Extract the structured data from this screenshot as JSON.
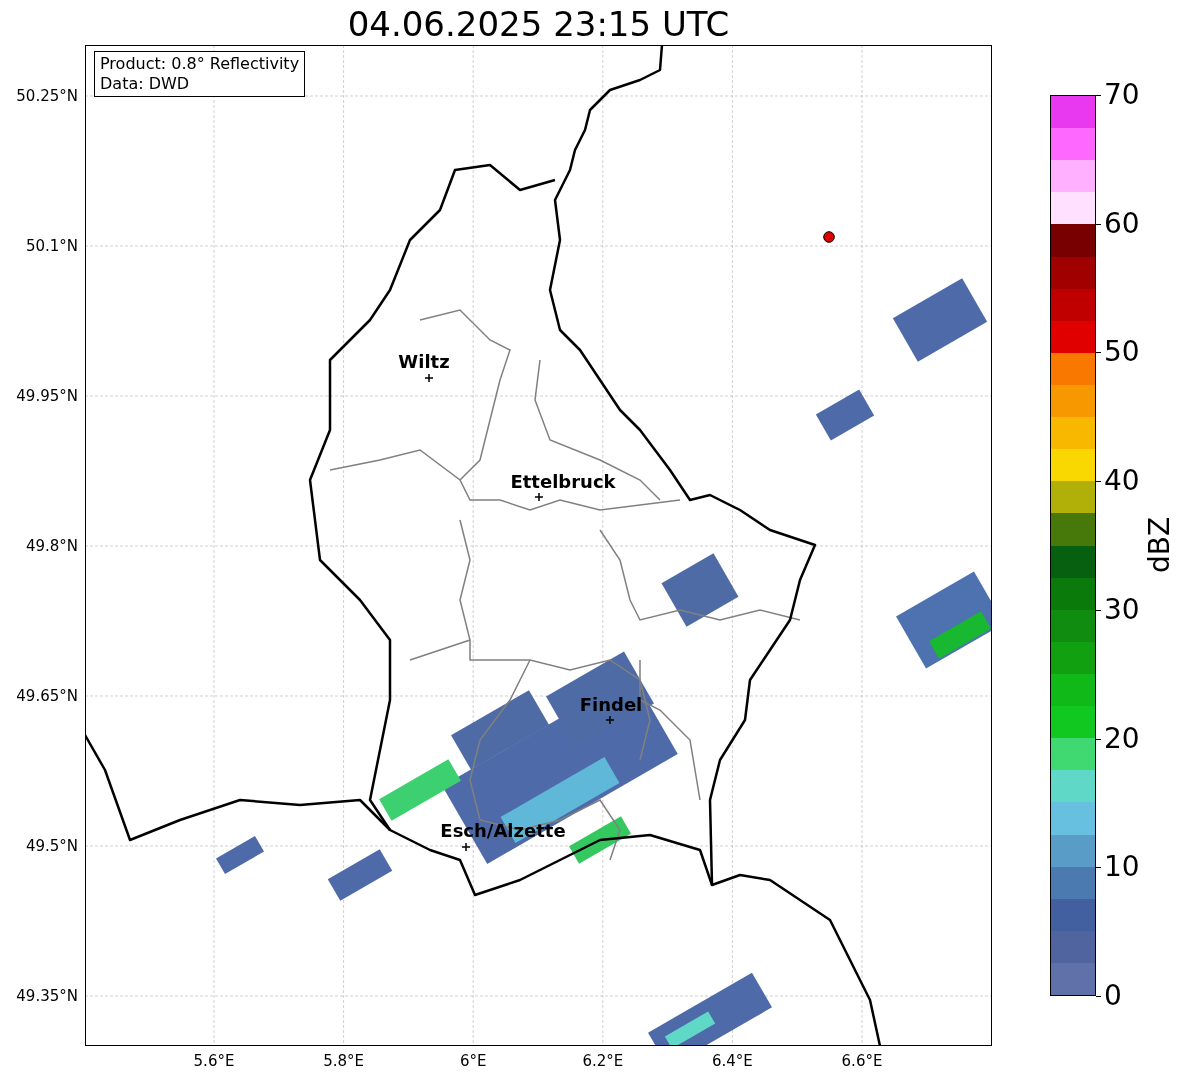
{
  "title": "04.06.2025 23:15 UTC",
  "legend": [
    "Product: 0.8° Reflectivity",
    "Data: DWD"
  ],
  "lat_ticks": [
    "50.25°N",
    "50.1°N",
    "49.95°N",
    "49.8°N",
    "49.65°N",
    "49.5°N",
    "49.35°N"
  ],
  "lon_ticks": [
    "5.6°E",
    "5.8°E",
    "6°E",
    "6.2°E",
    "6.4°E",
    "6.6°E"
  ],
  "cities": [
    {
      "name": "Wiltz"
    },
    {
      "name": "Ettelbruck"
    },
    {
      "name": "Findel"
    },
    {
      "name": "Esch/Alzette"
    }
  ],
  "colorbar": {
    "label": "dBZ",
    "ticks": [
      "70",
      "60",
      "50",
      "40",
      "30",
      "20",
      "10",
      "0"
    ],
    "segments": [
      {
        "color": "#e838f0"
      },
      {
        "color": "#ff68ff"
      },
      {
        "color": "#ffb0ff"
      },
      {
        "color": "#ffe0ff"
      },
      {
        "color": "#780000"
      },
      {
        "color": "#a00000"
      },
      {
        "color": "#c00000"
      },
      {
        "color": "#e00000"
      },
      {
        "color": "#f87800"
      },
      {
        "color": "#f89800"
      },
      {
        "color": "#f8b800"
      },
      {
        "color": "#f8d800"
      },
      {
        "color": "#b0b008"
      },
      {
        "color": "#46780a"
      },
      {
        "color": "#066010"
      },
      {
        "color": "#0a7a0a"
      },
      {
        "color": "#108c10"
      },
      {
        "color": "#10a010"
      },
      {
        "color": "#10b818"
      },
      {
        "color": "#10c820"
      },
      {
        "color": "#40d870"
      },
      {
        "color": "#60d8c8"
      },
      {
        "color": "#68c0e0"
      },
      {
        "color": "#5a9cc8"
      },
      {
        "color": "#4a7ab0"
      },
      {
        "color": "#4260a0"
      },
      {
        "color": "#5064a0"
      },
      {
        "color": "#6070a8"
      }
    ]
  }
}
